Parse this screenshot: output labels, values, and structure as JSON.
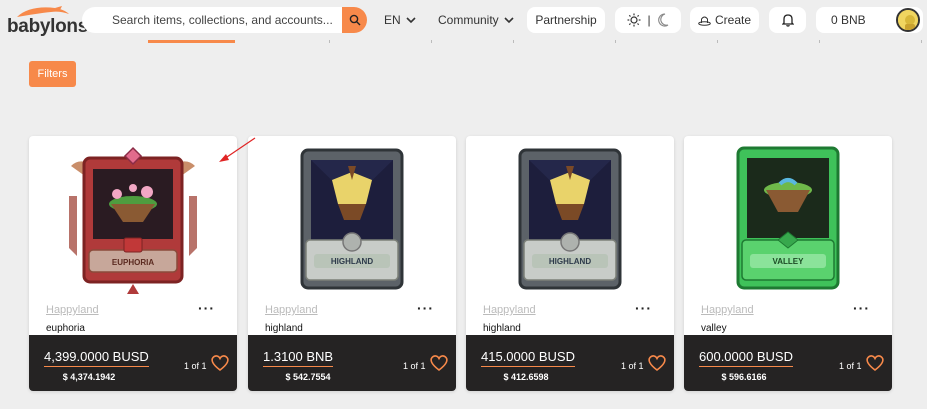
{
  "brand": {
    "name": "babylons"
  },
  "header": {
    "search_placeholder": "Search items, collections, and accounts...",
    "lang": "EN",
    "community": "Community",
    "partnership": "Partnership",
    "theme_separator": "|",
    "create": "Create",
    "wallet_balance": "0 BNB"
  },
  "filters_label": "Filters",
  "accent_color": "#f7894a",
  "cards": [
    {
      "collection": "Happyland",
      "name": "euphoria",
      "price": "4,399.0000 BUSD",
      "usd": "$ 4,374.1942",
      "edition": "1 of 1",
      "card_label": "EUPHORIA",
      "frame": "red"
    },
    {
      "collection": "Happyland",
      "name": "highland",
      "price": "1.3100 BNB",
      "usd": "$ 542.7554",
      "edition": "1 of 1",
      "card_label": "HIGHLAND",
      "frame": "grey"
    },
    {
      "collection": "Happyland",
      "name": "highland",
      "price": "415.0000 BUSD",
      "usd": "$ 412.6598",
      "edition": "1 of 1",
      "card_label": "HIGHLAND",
      "frame": "grey"
    },
    {
      "collection": "Happyland",
      "name": "valley",
      "price": "600.0000 BUSD",
      "usd": "$ 596.6166",
      "edition": "1 of 1",
      "card_label": "VALLEY",
      "frame": "green"
    }
  ]
}
